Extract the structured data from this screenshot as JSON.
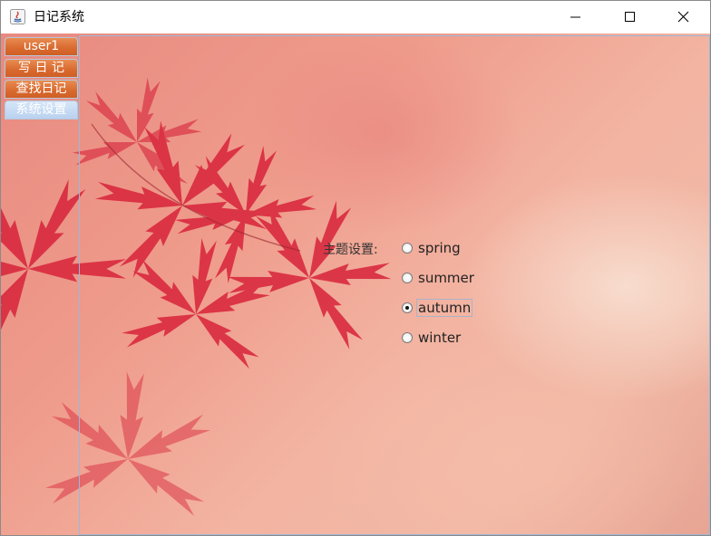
{
  "window": {
    "title": "日记系统"
  },
  "controls": {
    "minimize": "minimize",
    "maximize": "maximize",
    "close": "close"
  },
  "tabs": [
    {
      "label": "user1",
      "selected": false
    },
    {
      "label": "写 日 记",
      "selected": false
    },
    {
      "label": "查找日记",
      "selected": false
    },
    {
      "label": "系统设置",
      "selected": true
    }
  ],
  "settings": {
    "theme_label": "主题设置:",
    "options": [
      {
        "label": "spring",
        "checked": false
      },
      {
        "label": "summer",
        "checked": false
      },
      {
        "label": "autumn",
        "checked": true
      },
      {
        "label": "winter",
        "checked": false
      }
    ]
  },
  "colors": {
    "tab": "#d9692e",
    "tab_selected": "#b9d1ef",
    "background": "#f1b4a2"
  }
}
